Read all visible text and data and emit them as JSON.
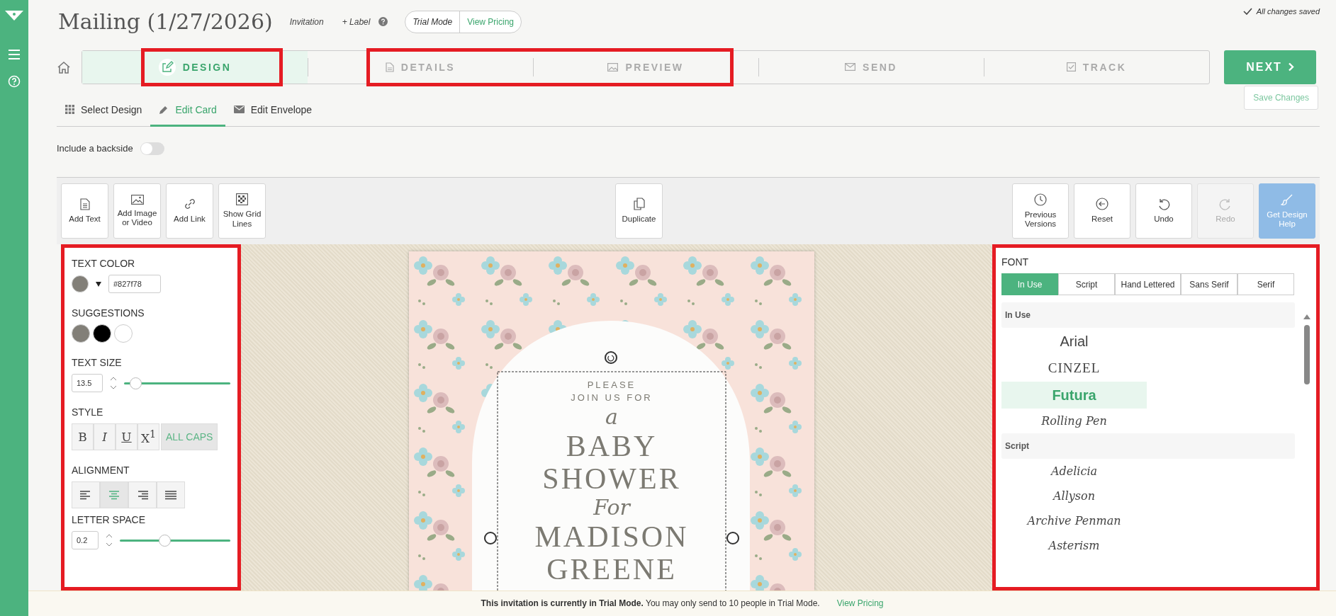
{
  "header": {
    "title": "Mailing (1/27/2026)",
    "type": "Invitation",
    "label_link": "+ Label",
    "trial": {
      "mode": "Trial Mode",
      "link": "View Pricing"
    },
    "save_status": "All changes saved"
  },
  "steps": [
    {
      "label": "DESIGN",
      "selected": true,
      "highlighted": true
    },
    {
      "label": "DETAILS",
      "selected": false,
      "highlighted": true
    },
    {
      "label": "PREVIEW",
      "selected": false,
      "highlighted": true,
      "joins_previous": true
    },
    {
      "label": "SEND",
      "selected": false,
      "highlighted": false
    },
    {
      "label": "TRACK",
      "selected": false,
      "highlighted": false
    }
  ],
  "next_button": "NEXT",
  "subtabs": [
    {
      "label": "Select Design",
      "selected": false
    },
    {
      "label": "Edit Card",
      "selected": true
    },
    {
      "label": "Edit Envelope",
      "selected": false
    }
  ],
  "save_changes": "Save Changes",
  "backside": {
    "label": "Include a backside",
    "on": false
  },
  "toolbar": {
    "left": [
      {
        "label": "Add Text",
        "kind": "plain",
        "disabled": false
      },
      {
        "label": "Add Image or Video",
        "kind": "plain",
        "disabled": false
      },
      {
        "label": "Add Link",
        "kind": "plain",
        "disabled": false
      },
      {
        "label": "Show Grid Lines",
        "kind": "plain",
        "disabled": false
      }
    ],
    "center": [
      {
        "label": "Duplicate",
        "kind": "plain",
        "disabled": false
      }
    ],
    "right": [
      {
        "label": "Previous Versions",
        "kind": "plain",
        "disabled": false
      },
      {
        "label": "Reset",
        "kind": "plain",
        "disabled": false
      },
      {
        "label": "Undo",
        "kind": "plain",
        "disabled": false
      },
      {
        "label": "Redo",
        "kind": "plain",
        "disabled": true
      },
      {
        "label": "Get Design Help",
        "kind": "primary",
        "disabled": false
      }
    ]
  },
  "text_panel": {
    "text_color": {
      "heading": "TEXT COLOR",
      "color": "#827f78",
      "value": "#827f78"
    },
    "suggestions": {
      "heading": "SUGGESTIONS",
      "swatches": [
        {
          "color": "#827f78"
        },
        {
          "color": "#000000"
        },
        {
          "color": "#ffffff"
        }
      ]
    },
    "text_size": {
      "heading": "TEXT SIZE",
      "value": "13.5",
      "level": 0.1
    },
    "style": {
      "heading": "STYLE",
      "buttons": [
        {
          "label": "B",
          "selected": false
        },
        {
          "label": "I",
          "selected": false
        },
        {
          "label": "U",
          "selected": false
        },
        {
          "label": "X$^{1}$",
          "selected": false
        }
      ],
      "all_caps": {
        "label": "ALL CAPS",
        "selected": true
      }
    },
    "alignment": {
      "heading": "ALIGNMENT",
      "options": [
        {
          "selected": false
        },
        {
          "selected": true
        },
        {
          "selected": false
        },
        {
          "selected": false
        }
      ]
    },
    "letter_space": {
      "heading": "LETTER SPACE",
      "value": "0.2",
      "level": 0.4
    }
  },
  "card": {
    "lines": [
      {
        "text": "PLEASE",
        "kind": "small"
      },
      {
        "text": "JOIN US FOR",
        "kind": "small"
      },
      {
        "text": "a",
        "kind": "script"
      },
      {
        "text": "BABY",
        "kind": "large"
      },
      {
        "text": "SHOWER",
        "kind": "large"
      },
      {
        "text": "For",
        "kind": "script"
      },
      {
        "text": "MADISON",
        "kind": "large"
      },
      {
        "text": "GREENE",
        "kind": "large"
      }
    ]
  },
  "font_panel": {
    "heading": "FONT",
    "tabs": [
      {
        "label": "In Use",
        "selected": true
      },
      {
        "label": "Script",
        "selected": false
      },
      {
        "label": "Hand Lettered",
        "selected": false
      },
      {
        "label": "Sans Serif",
        "selected": false
      },
      {
        "label": "Serif",
        "selected": false
      }
    ],
    "groups": [
      {
        "title": "In Use",
        "fonts": [
          {
            "name": "Arial",
            "kind": "sans",
            "selected": false
          },
          {
            "name": "CINZEL",
            "kind": "serif",
            "selected": false
          },
          {
            "name": "Futura",
            "kind": "sans",
            "selected": true
          },
          {
            "name": "Rolling Pen",
            "kind": "script",
            "selected": false
          }
        ]
      },
      {
        "title": "Script",
        "fonts": [
          {
            "name": "Adelicia",
            "kind": "script",
            "selected": false
          },
          {
            "name": "Allyson",
            "kind": "script",
            "selected": false
          },
          {
            "name": "Archive Penman",
            "kind": "script",
            "selected": false
          },
          {
            "name": "Asterism",
            "kind": "script",
            "selected": false
          }
        ]
      }
    ]
  },
  "bottom_bar": {
    "message": "**This invitation is currently in Trial Mode.** You may only send to 10 people in Trial Mode.",
    "link": "View Pricing"
  }
}
